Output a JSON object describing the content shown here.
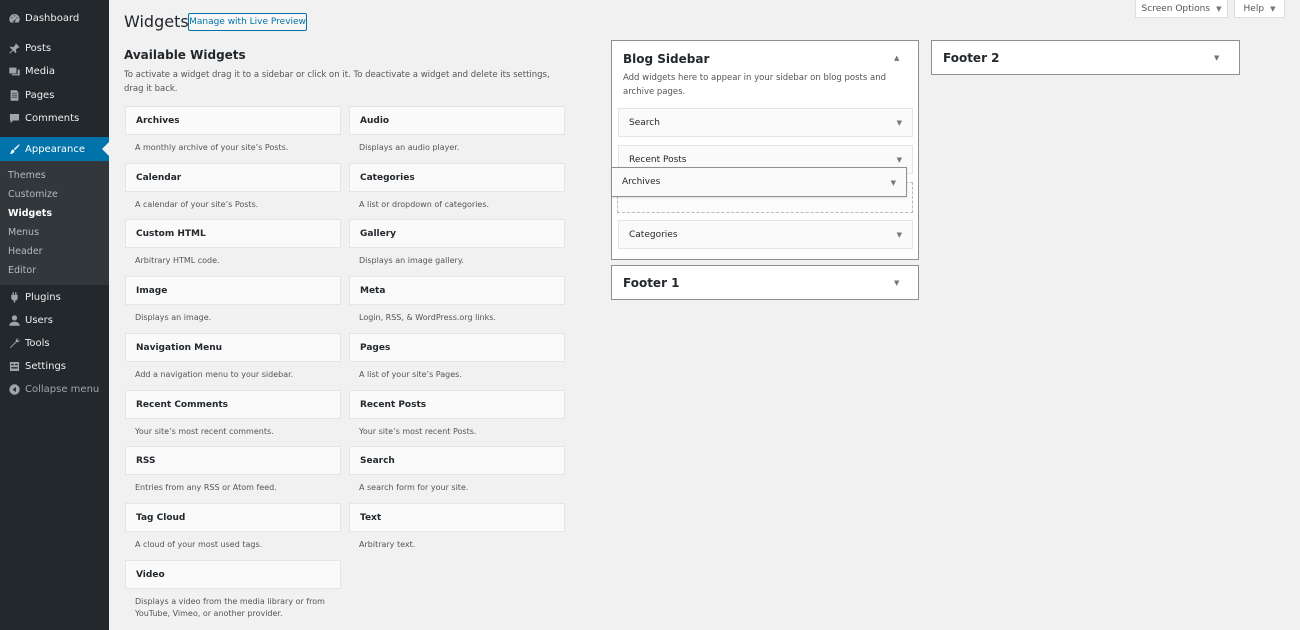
{
  "admin_menu": {
    "items": [
      {
        "label": "Dashboard",
        "icon": "dashboard-icon"
      },
      {
        "label": "Posts",
        "icon": "pin-icon"
      },
      {
        "label": "Media",
        "icon": "media-icon"
      },
      {
        "label": "Pages",
        "icon": "pages-icon"
      },
      {
        "label": "Comments",
        "icon": "comment-icon"
      },
      {
        "label": "Appearance",
        "icon": "brush-icon"
      },
      {
        "label": "Plugins",
        "icon": "plugin-icon"
      },
      {
        "label": "Users",
        "icon": "user-icon"
      },
      {
        "label": "Tools",
        "icon": "wrench-icon"
      },
      {
        "label": "Settings",
        "icon": "settings-icon"
      },
      {
        "label": "Collapse menu",
        "icon": "collapse-icon"
      }
    ],
    "submenu": [
      "Themes",
      "Customize",
      "Widgets",
      "Menus",
      "Header",
      "Editor"
    ]
  },
  "top_buttons": {
    "screen_options": "Screen Options",
    "help": "Help"
  },
  "header": {
    "title": "Widgets",
    "live_preview": "Manage with Live Preview"
  },
  "available": {
    "heading": "Available Widgets",
    "description": "To activate a widget drag it to a sidebar or click on it. To deactivate a widget and delete its settings, drag it back.",
    "widgets": [
      {
        "name": "Archives",
        "desc": "A monthly archive of your site’s Posts."
      },
      {
        "name": "Audio",
        "desc": "Displays an audio player."
      },
      {
        "name": "Calendar",
        "desc": "A calendar of your site’s Posts."
      },
      {
        "name": "Categories",
        "desc": "A list or dropdown of categories."
      },
      {
        "name": "Custom HTML",
        "desc": "Arbitrary HTML code."
      },
      {
        "name": "Gallery",
        "desc": "Displays an image gallery."
      },
      {
        "name": "Image",
        "desc": "Displays an image."
      },
      {
        "name": "Meta",
        "desc": "Login, RSS, & WordPress.org links."
      },
      {
        "name": "Navigation Menu",
        "desc": "Add a navigation menu to your sidebar."
      },
      {
        "name": "Pages",
        "desc": "A list of your site’s Pages."
      },
      {
        "name": "Recent Comments",
        "desc": "Your site’s most recent comments."
      },
      {
        "name": "Recent Posts",
        "desc": "Your site’s most recent Posts."
      },
      {
        "name": "RSS",
        "desc": "Entries from any RSS or Atom feed."
      },
      {
        "name": "Search",
        "desc": "A search form for your site."
      },
      {
        "name": "Tag Cloud",
        "desc": "A cloud of your most used tags."
      },
      {
        "name": "Text",
        "desc": "Arbitrary text."
      },
      {
        "name": "Video",
        "desc": "Displays a video from the media library or from YouTube, Vimeo, or another provider."
      }
    ]
  },
  "sidebars": {
    "blog": {
      "title": "Blog Sidebar",
      "description": "Add widgets here to appear in your sidebar on blog posts and archive pages.",
      "widgets": [
        "Search",
        "Recent Posts",
        "Categories"
      ]
    },
    "footer1": {
      "title": "Footer 1"
    },
    "footer2": {
      "title": "Footer 2"
    },
    "dragging": "Archives"
  },
  "colors": {
    "accent": "#0073aa",
    "sidebar_bg": "#23282d",
    "submenu_bg": "#32373c"
  }
}
